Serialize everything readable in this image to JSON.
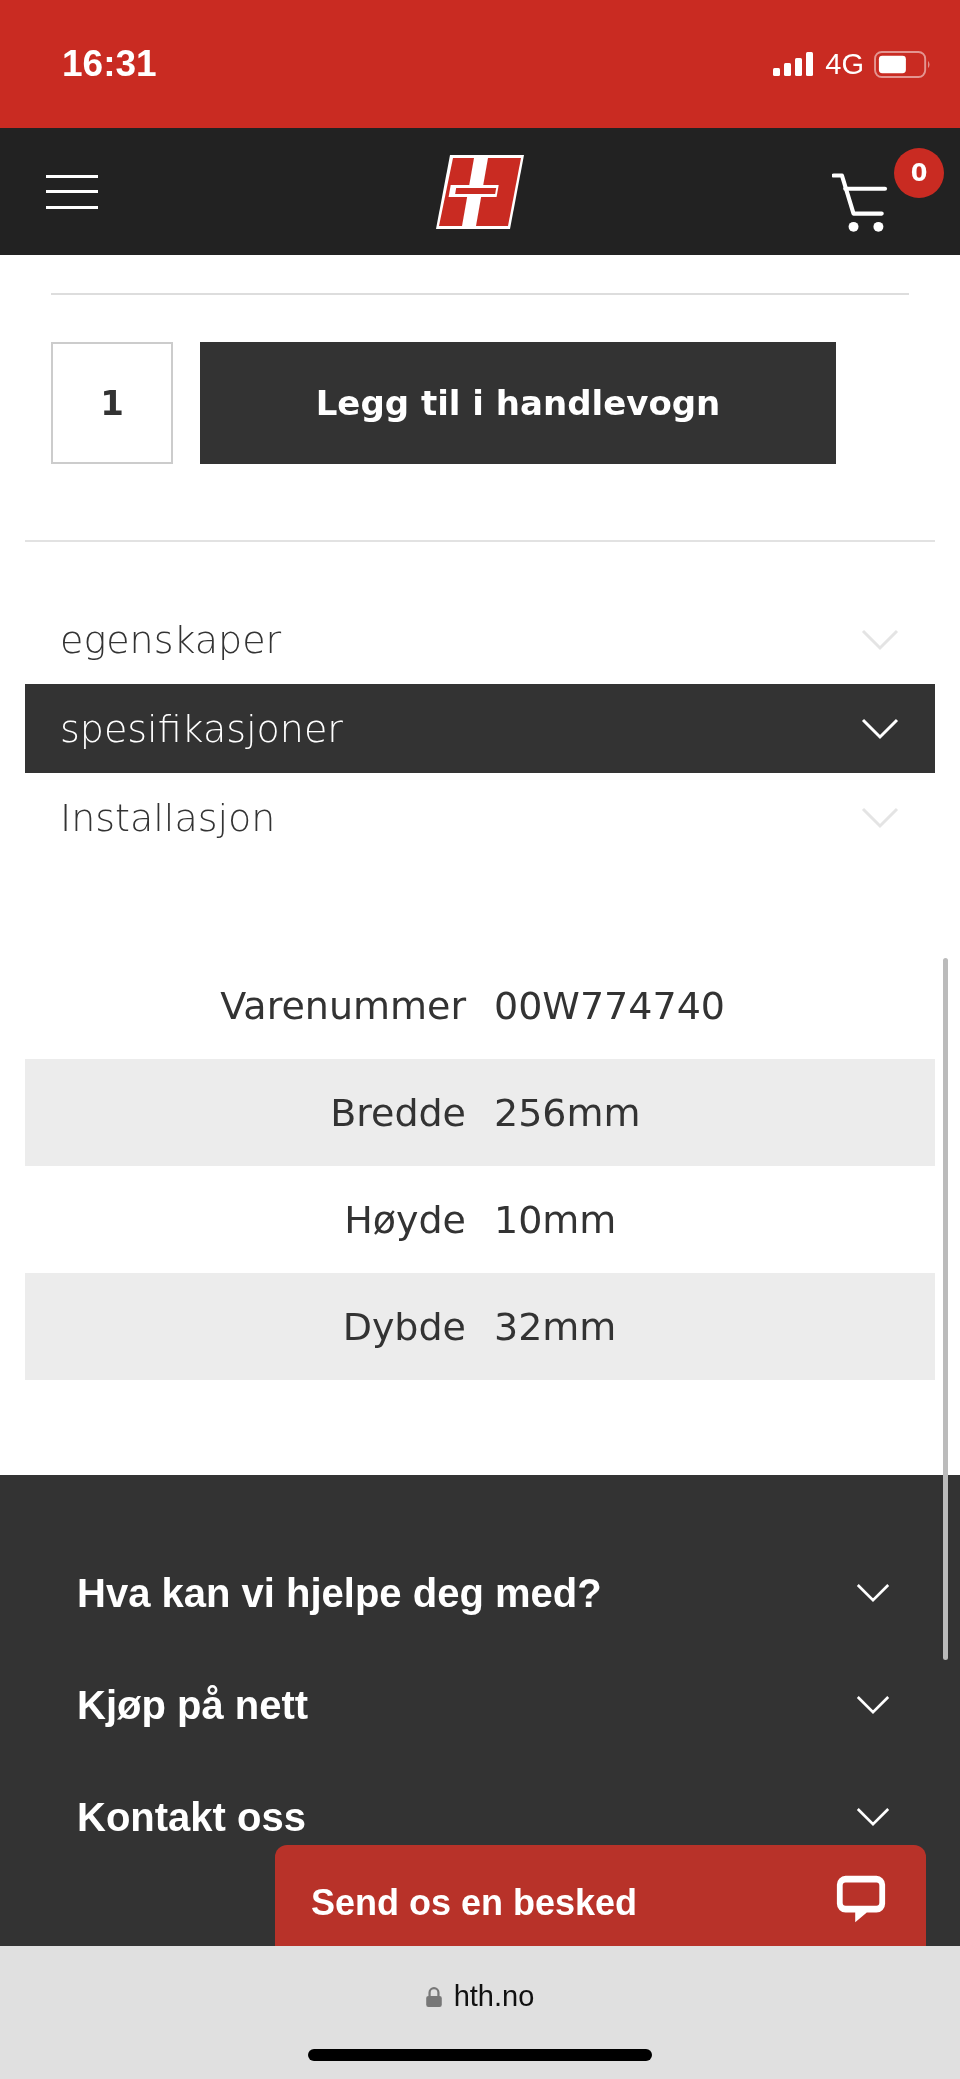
{
  "status_bar": {
    "time": "16:31",
    "network": "4G"
  },
  "header": {
    "cart_count": "0"
  },
  "purchase": {
    "quantity": "1",
    "add_button": "Legg til i handlevogn"
  },
  "accordion": [
    {
      "label": "egenskaper",
      "expanded": false
    },
    {
      "label": "spesifikasjoner",
      "expanded": true
    },
    {
      "label": "Installasjon",
      "expanded": false
    }
  ],
  "specs": [
    {
      "label": "Varenummer",
      "value": "00W774740"
    },
    {
      "label": "Bredde",
      "value": "256mm"
    },
    {
      "label": "Høyde",
      "value": "10mm"
    },
    {
      "label": "Dybde",
      "value": "32mm"
    }
  ],
  "footer": {
    "items": [
      {
        "label": "Hva kan vi hjelpe deg med?"
      },
      {
        "label": "Kjøp på nett"
      },
      {
        "label": "Kontakt oss"
      }
    ]
  },
  "chat_button": {
    "label": "Send os en besked"
  },
  "browser_bar": {
    "url": "hth.no"
  }
}
